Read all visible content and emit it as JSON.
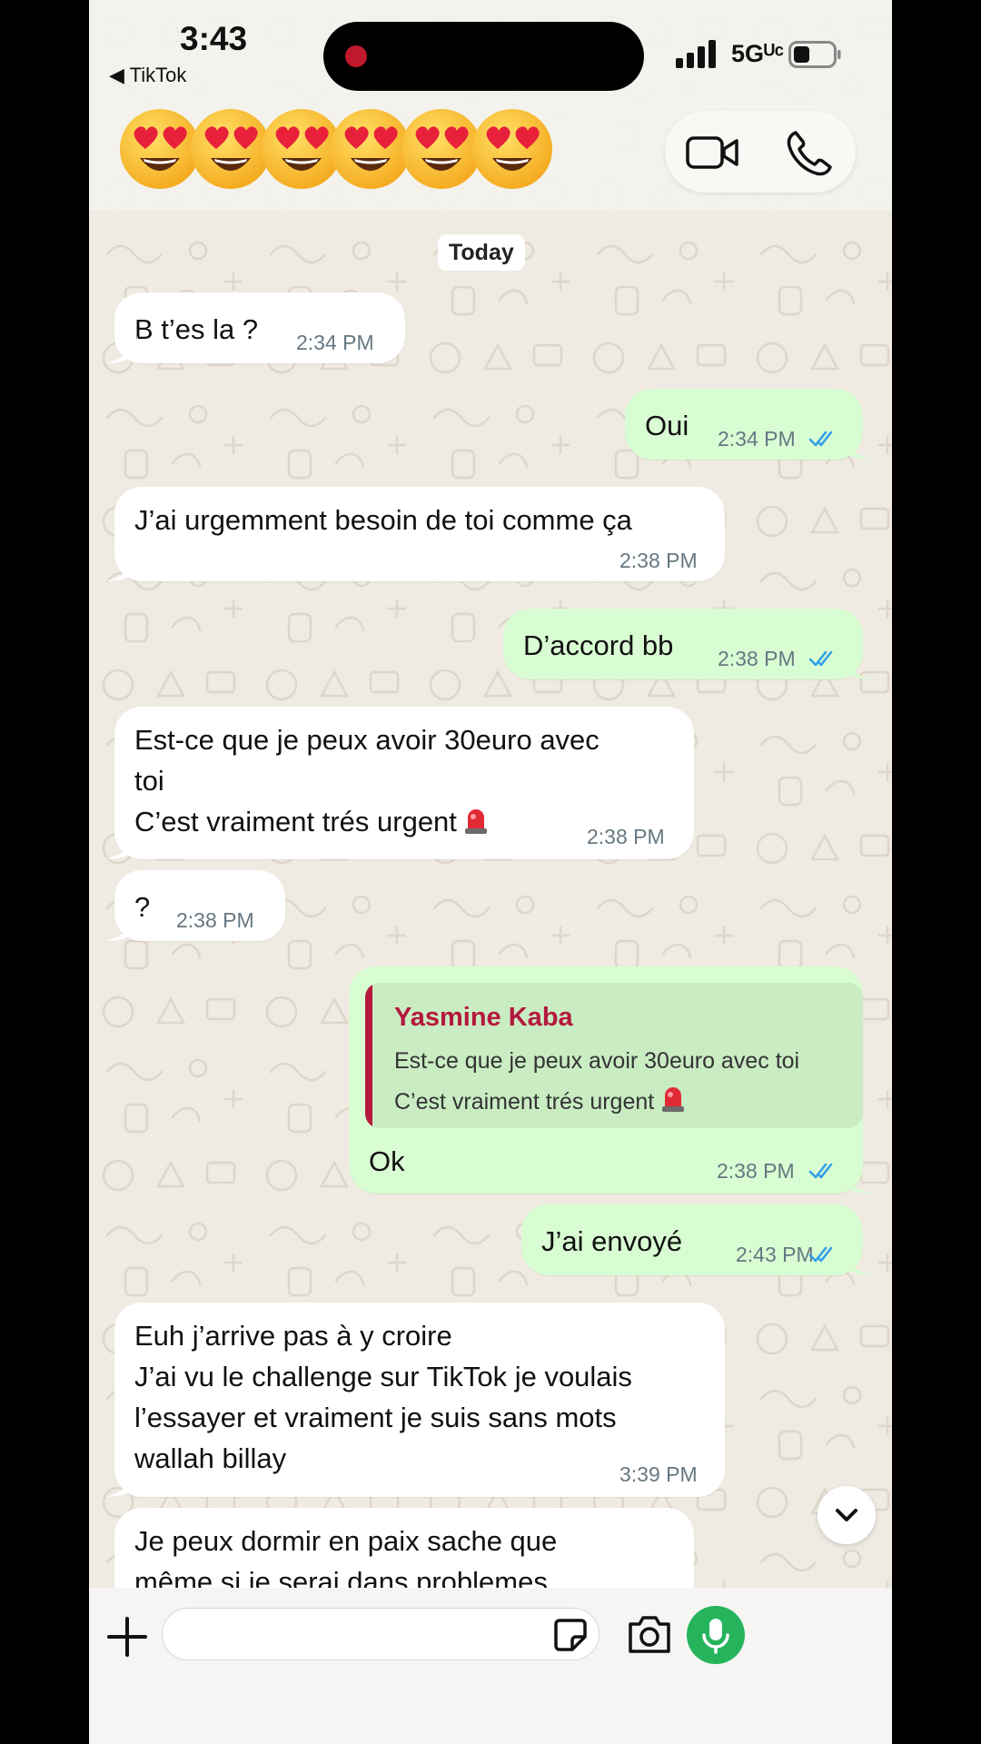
{
  "status_bar": {
    "time": "3:43",
    "back_app": "◀ TikTok",
    "network": "5Gᵁᶜ"
  },
  "header": {
    "emoji_icon": "heart-eyes-emoji",
    "emoji_count": 6,
    "video_call_icon": "video-camera-icon",
    "voice_call_icon": "phone-icon"
  },
  "date_chip": "Today",
  "messages": [
    {
      "dir": "in",
      "lines": [
        "B t’es la ?"
      ],
      "time": "2:34 PM"
    },
    {
      "dir": "out",
      "lines": [
        "Oui"
      ],
      "time": "2:34 PM",
      "read": true
    },
    {
      "dir": "in",
      "lines": [
        "J’ai urgemment besoin de toi comme ça"
      ],
      "time": "2:38 PM"
    },
    {
      "dir": "out",
      "lines": [
        "D’accord bb"
      ],
      "time": "2:38 PM",
      "read": true
    },
    {
      "dir": "in",
      "lines": [
        "Est-ce que je peux avoir 30euro avec",
        "toi",
        "C’est vraiment trés urgent"
      ],
      "time": "2:38 PM",
      "emoji": "rotating-light-emoji"
    },
    {
      "dir": "in",
      "lines": [
        "?"
      ],
      "time": "2:38 PM"
    },
    {
      "dir": "out",
      "lines": [
        "Ok"
      ],
      "time": "2:38 PM",
      "read": true,
      "quote": {
        "name": "Yasmine Kaba",
        "lines": [
          "Est-ce que je peux avoir 30euro avec toi",
          "C’est vraiment trés urgent"
        ]
      }
    },
    {
      "dir": "out",
      "lines": [
        "J’ai envoyé"
      ],
      "time": "2:43 PM",
      "read": true
    },
    {
      "dir": "in",
      "lines": [
        "Euh j’arrive pas à y croire",
        "J’ai vu le challenge sur TikTok je voulais",
        "l’essayer et vraiment je suis sans mots",
        "wallah billay"
      ],
      "time": "3:39 PM"
    },
    {
      "dir": "in",
      "lines": [
        "Je peux dormir en paix sache que",
        "même si je serai dans problemes"
      ]
    }
  ],
  "input": {
    "value": "",
    "placeholder": ""
  },
  "colors": {
    "incoming": "#ffffff",
    "outgoing": "#d9fdd3",
    "read_ticks": "#34a0e6",
    "quote_accent": "#b5183c",
    "mic": "#25b45c"
  }
}
